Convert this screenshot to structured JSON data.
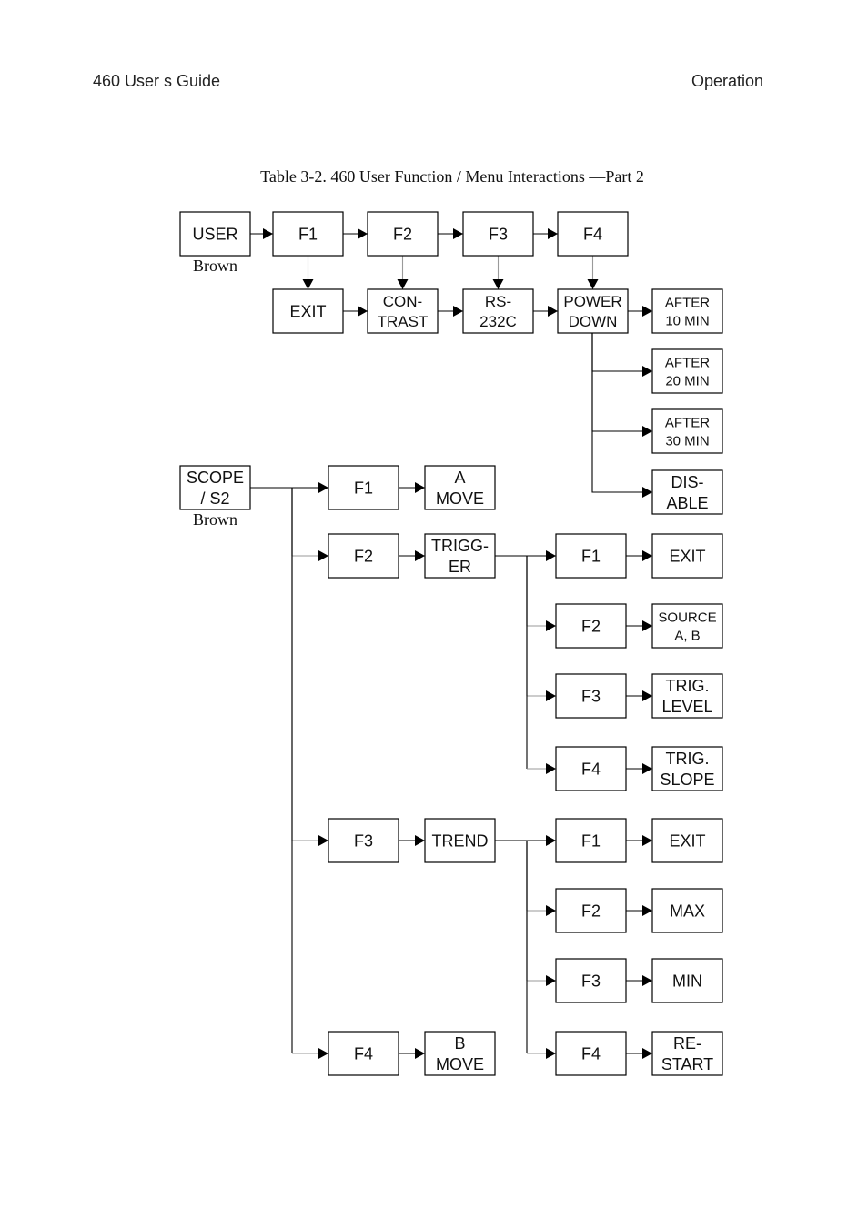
{
  "header": {
    "left": "460 User s Guide",
    "right": "Operation"
  },
  "caption": "Table 3-2.   460 User Function / Menu Interactions —Part 2",
  "diagram": {
    "nodes": [
      {
        "id": "user",
        "lines": [
          "USER"
        ],
        "sublabel": "Brown"
      },
      {
        "id": "u_f1",
        "lines": [
          "F1"
        ]
      },
      {
        "id": "u_f2",
        "lines": [
          "F2"
        ]
      },
      {
        "id": "u_f3",
        "lines": [
          "F3"
        ]
      },
      {
        "id": "u_f4",
        "lines": [
          "F4"
        ]
      },
      {
        "id": "u_exit",
        "lines": [
          "EXIT"
        ]
      },
      {
        "id": "u_contrast",
        "lines": [
          "CON-",
          "TRAST"
        ]
      },
      {
        "id": "u_rs232c",
        "lines": [
          "RS-",
          "232C"
        ]
      },
      {
        "id": "u_powerdown",
        "lines": [
          "POWER",
          "DOWN"
        ]
      },
      {
        "id": "pd_10",
        "lines": [
          "AFTER",
          "10 MIN"
        ]
      },
      {
        "id": "pd_20",
        "lines": [
          "AFTER",
          "20 MIN"
        ]
      },
      {
        "id": "pd_30",
        "lines": [
          "AFTER",
          "30 MIN"
        ]
      },
      {
        "id": "pd_disable",
        "lines": [
          "DIS-",
          "ABLE"
        ]
      },
      {
        "id": "scope",
        "lines": [
          "SCOPE",
          "/ S2"
        ],
        "sublabel": "Brown"
      },
      {
        "id": "s_f1",
        "lines": [
          "F1"
        ]
      },
      {
        "id": "s_amove",
        "lines": [
          "A",
          "MOVE"
        ]
      },
      {
        "id": "s_f2",
        "lines": [
          "F2"
        ]
      },
      {
        "id": "s_trigger",
        "lines": [
          "TRIGG-",
          "ER"
        ]
      },
      {
        "id": "t_f1",
        "lines": [
          "F1"
        ]
      },
      {
        "id": "t_exit",
        "lines": [
          "EXIT"
        ]
      },
      {
        "id": "t_f2",
        "lines": [
          "F2"
        ]
      },
      {
        "id": "t_source",
        "lines": [
          "SOURCE",
          "A, B"
        ]
      },
      {
        "id": "t_f3",
        "lines": [
          "F3"
        ]
      },
      {
        "id": "t_level",
        "lines": [
          "TRIG.",
          "LEVEL"
        ]
      },
      {
        "id": "t_f4",
        "lines": [
          "F4"
        ]
      },
      {
        "id": "t_slope",
        "lines": [
          "TRIG.",
          "SLOPE"
        ]
      },
      {
        "id": "s_f3",
        "lines": [
          "F3"
        ]
      },
      {
        "id": "s_trend",
        "lines": [
          "TREND"
        ]
      },
      {
        "id": "r_f1",
        "lines": [
          "F1"
        ]
      },
      {
        "id": "r_exit",
        "lines": [
          "EXIT"
        ]
      },
      {
        "id": "r_f2",
        "lines": [
          "F2"
        ]
      },
      {
        "id": "r_max",
        "lines": [
          "MAX"
        ]
      },
      {
        "id": "r_f3",
        "lines": [
          "F3"
        ]
      },
      {
        "id": "r_min",
        "lines": [
          "MIN"
        ]
      },
      {
        "id": "r_f4",
        "lines": [
          "F4"
        ]
      },
      {
        "id": "r_restart",
        "lines": [
          "RE-",
          "START"
        ]
      },
      {
        "id": "s_f4",
        "lines": [
          "F4"
        ]
      },
      {
        "id": "s_bmove",
        "lines": [
          "B",
          "MOVE"
        ]
      }
    ],
    "edges": [
      [
        "user",
        "u_f1"
      ],
      [
        "u_f1",
        "u_f2"
      ],
      [
        "u_f2",
        "u_f3"
      ],
      [
        "u_f3",
        "u_f4"
      ],
      [
        "u_f1",
        "u_exit"
      ],
      [
        "u_f2",
        "u_contrast"
      ],
      [
        "u_f3",
        "u_rs232c"
      ],
      [
        "u_f4",
        "u_powerdown"
      ],
      [
        "u_exit",
        "u_contrast"
      ],
      [
        "u_contrast",
        "u_rs232c"
      ],
      [
        "u_rs232c",
        "u_powerdown"
      ],
      [
        "u_powerdown",
        "pd_10"
      ],
      [
        "u_powerdown",
        "pd_20"
      ],
      [
        "u_powerdown",
        "pd_30"
      ],
      [
        "u_powerdown",
        "pd_disable"
      ],
      [
        "scope",
        "s_f1"
      ],
      [
        "scope",
        "s_f2"
      ],
      [
        "scope",
        "s_f3"
      ],
      [
        "scope",
        "s_f4"
      ],
      [
        "s_f1",
        "s_amove"
      ],
      [
        "s_f2",
        "s_trigger"
      ],
      [
        "s_f3",
        "s_trend"
      ],
      [
        "s_f4",
        "s_bmove"
      ],
      [
        "s_trigger",
        "t_f1"
      ],
      [
        "s_trigger",
        "t_f2"
      ],
      [
        "s_trigger",
        "t_f3"
      ],
      [
        "s_trigger",
        "t_f4"
      ],
      [
        "t_f1",
        "t_exit"
      ],
      [
        "t_f2",
        "t_source"
      ],
      [
        "t_f3",
        "t_level"
      ],
      [
        "t_f4",
        "t_slope"
      ],
      [
        "s_trend",
        "r_f1"
      ],
      [
        "s_trend",
        "r_f2"
      ],
      [
        "s_trend",
        "r_f3"
      ],
      [
        "s_trend",
        "r_f4"
      ],
      [
        "r_f1",
        "r_exit"
      ],
      [
        "r_f2",
        "r_max"
      ],
      [
        "r_f3",
        "r_min"
      ],
      [
        "r_f4",
        "r_restart"
      ]
    ]
  }
}
